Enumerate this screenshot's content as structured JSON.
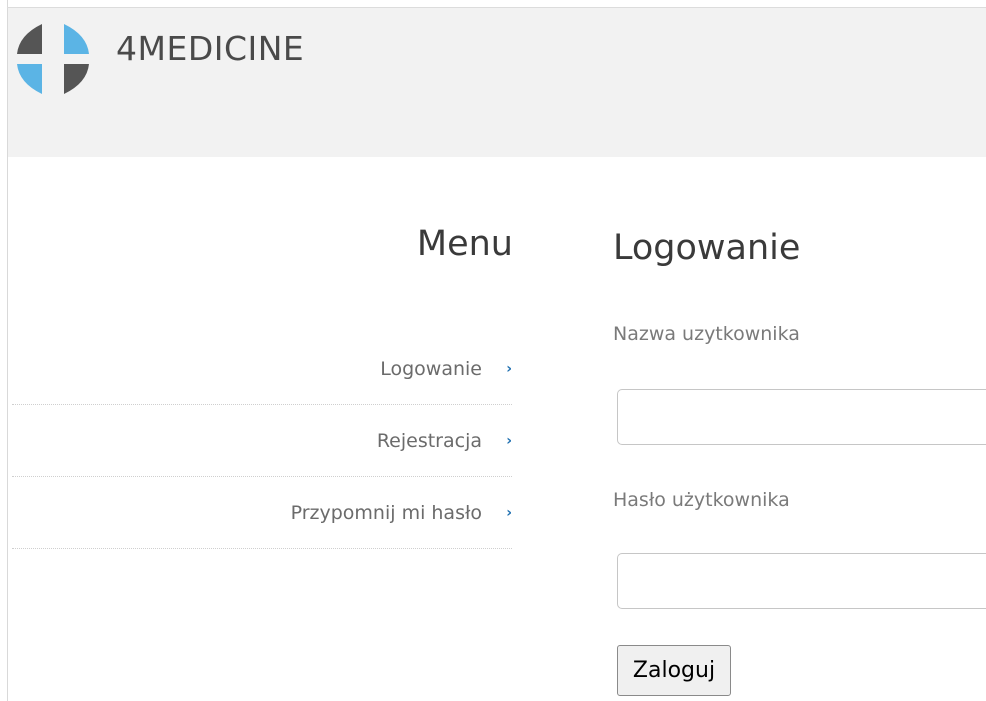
{
  "header": {
    "brand": "4MEDICINE",
    "logo_colors": {
      "dark": "#555555",
      "blue": "#5bb4e5"
    }
  },
  "menu": {
    "title": "Menu",
    "items": [
      {
        "label": "Logowanie"
      },
      {
        "label": "Rejestracja"
      },
      {
        "label": "Przypomnij mi hasło"
      }
    ],
    "chevron": "›",
    "chevron_color": "#1e6fb0"
  },
  "login": {
    "title": "Logowanie",
    "username_label": "Nazwa uzytkownika",
    "username_value": "",
    "password_label": "Hasło użytkownika",
    "password_value": "",
    "submit_label": "Zaloguj"
  }
}
